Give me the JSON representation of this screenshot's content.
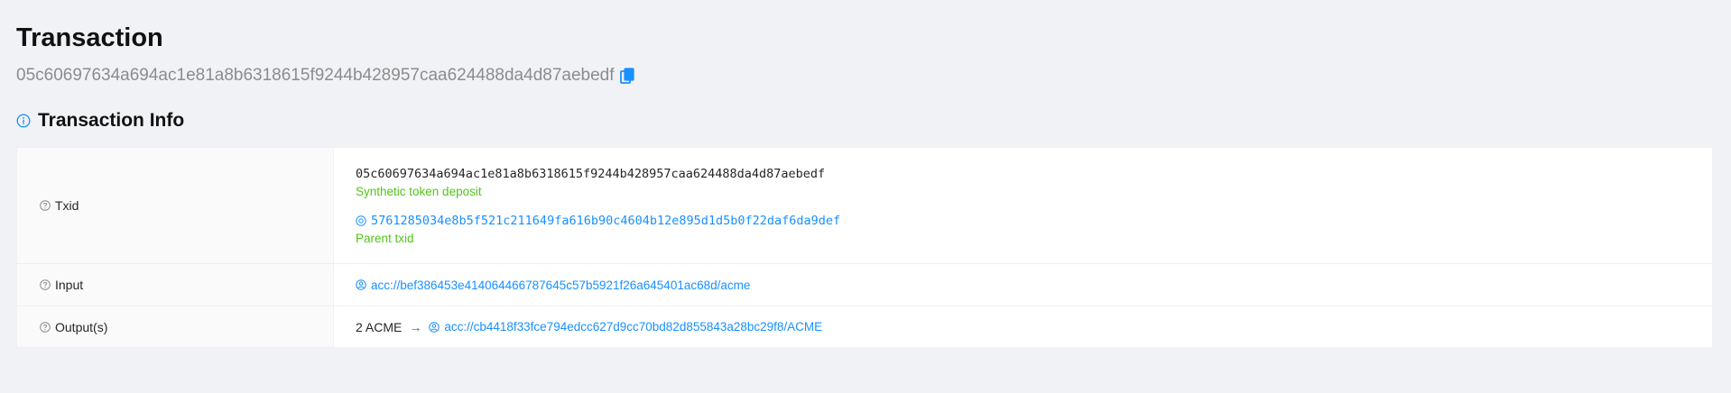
{
  "header": {
    "title": "Transaction",
    "txid": "05c60697634a694ac1e81a8b6318615f9244b428957caa624488da4d87aebedf"
  },
  "section": {
    "title": "Transaction Info"
  },
  "rows": {
    "txid": {
      "label": "Txid",
      "value": "05c60697634a694ac1e81a8b6318615f9244b428957caa624488da4d87aebedf",
      "tag": "Synthetic token deposit",
      "parent_value": "5761285034e8b5f521c211649fa616b90c4604b12e895d1d5b0f22daf6da9def",
      "parent_tag": "Parent txid"
    },
    "input": {
      "label": "Input",
      "value": "acc://bef386453e414064466787645c57b5921f26a645401ac68d/acme"
    },
    "outputs": {
      "label": "Output(s)",
      "amount": "2 ACME",
      "arrow": "→",
      "value": "acc://cb4418f33fce794edcc627d9cc70bd82d855843a28bc29f8/ACME"
    }
  },
  "colors": {
    "link": "#1890ff",
    "success": "#52c41a",
    "background": "#f0f2f5"
  }
}
